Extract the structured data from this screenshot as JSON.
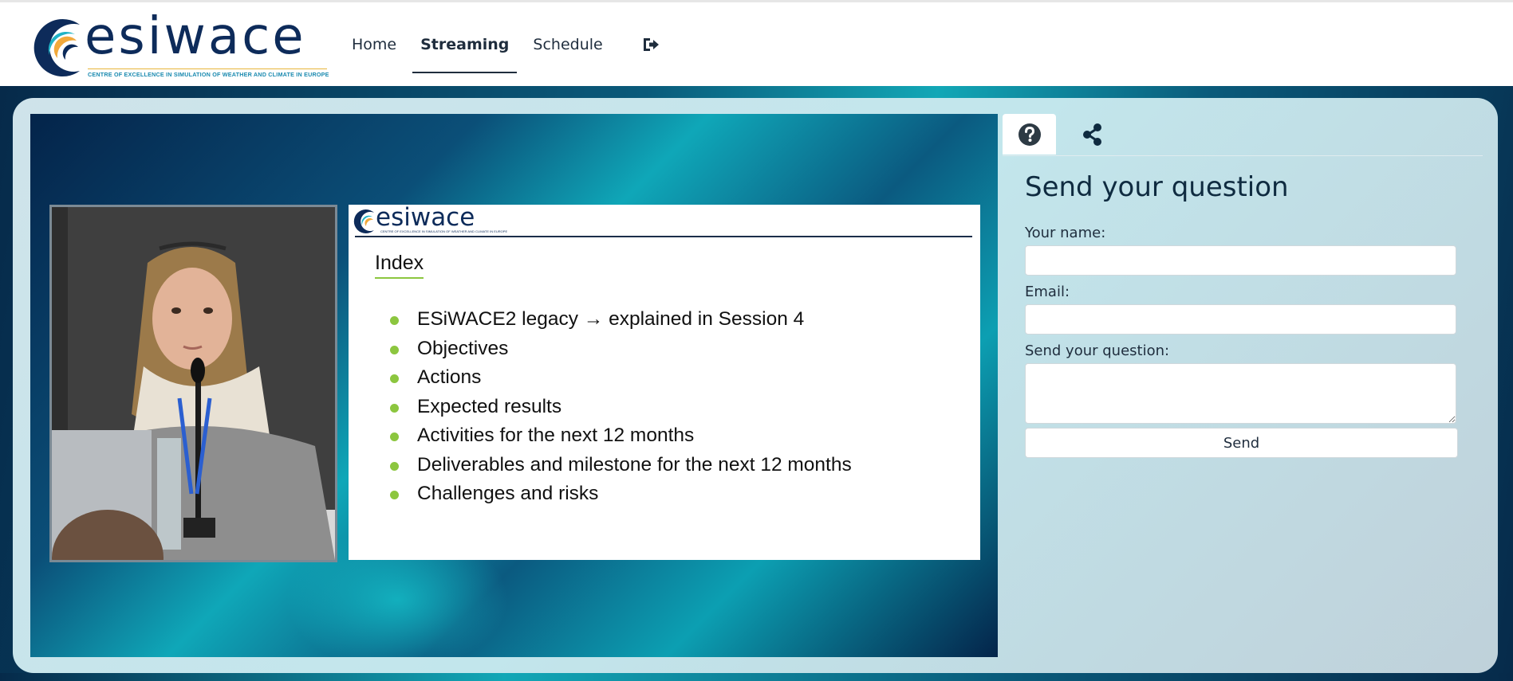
{
  "header": {
    "logo_word": "esiwace",
    "logo_tagline": "CENTRE OF EXCELLENCE IN SIMULATION OF WEATHER AND CLIMATE IN EUROPE",
    "nav": [
      {
        "label": "Home",
        "active": false
      },
      {
        "label": "Streaming",
        "active": true
      },
      {
        "label": "Schedule",
        "active": false
      }
    ],
    "logout_icon": "sign-out-icon"
  },
  "video": {
    "slide": {
      "logo_word": "esiwace",
      "logo_tagline": "CENTRE OF EXCELLENCE IN SIMULATION OF WEATHER AND CLIMATE IN EUROPE",
      "title": "Index",
      "items": [
        "ESiWACE2 legacy → explained in Session 4",
        "Objectives",
        "Actions",
        "Expected results",
        "Activities for the next 12 months",
        "Deliverables and milestone for the next 12 months",
        "Challenges and risks"
      ],
      "bullet_color": "#8cc63f"
    }
  },
  "panel": {
    "tabs": [
      {
        "icon": "question-circle-icon",
        "active": true
      },
      {
        "icon": "share-icon",
        "active": false
      }
    ],
    "title": "Send your question",
    "name_label": "Your name:",
    "email_label": "Email:",
    "question_label": "Send your question:",
    "name_value": "",
    "email_value": "",
    "question_value": "",
    "send_label": "Send"
  },
  "colors": {
    "brand_navy": "#0d2b5a",
    "brand_teal": "#12a7b6",
    "accent_green": "#8cc63f"
  }
}
